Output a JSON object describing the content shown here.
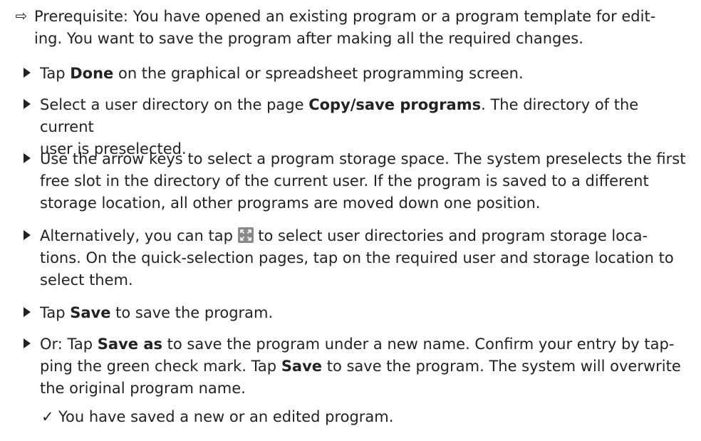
{
  "prerequisite": {
    "marker": "⇨",
    "line1": "Prerequisite: You have opened an existing program or a program template for edit-",
    "line2": "ing. You want to save the program after making all the required changes."
  },
  "steps": [
    {
      "parts": [
        {
          "t": "Tap "
        },
        {
          "b": "Done"
        },
        {
          "t": " on the graphical or spreadsheet programming screen."
        }
      ]
    },
    {
      "line1": [
        {
          "t": "Select a user directory on the page "
        },
        {
          "b": "Copy/save programs"
        },
        {
          "t": ". The directory of the current"
        }
      ],
      "line2": "user is preselected."
    },
    {
      "line1": "Use the arrow keys to select a program storage space. The system preselects the first",
      "line2": "free slot in the directory of the current user. If the program is saved to a different",
      "line3": "storage location, all other programs are moved down one position."
    },
    {
      "line1a": "Alternatively, you can tap ",
      "icon": "fullscreen-expand-icon",
      "line1b": " to select user directories and program storage loca-",
      "line2": "tions. On the quick-selection pages, tap on the required user and storage location to",
      "line3": "select them."
    },
    {
      "a": "Tap ",
      "b": "Save",
      "c": " to save the program."
    },
    {
      "l1a": "Or: Tap ",
      "l1b": "Save as",
      "l1c": " to save the program under a new name. Confirm your entry by tap-",
      "l2a": "ping the green check mark. Tap ",
      "l2b": "Save",
      "l2c": " to save the program. The system will overwrite",
      "l3": "the original program name."
    }
  ],
  "result": {
    "marker": "✓",
    "text": "You have saved a new or an edited program."
  },
  "colors": {
    "text": "#222222",
    "icon_bg": "#8a8a8a"
  }
}
